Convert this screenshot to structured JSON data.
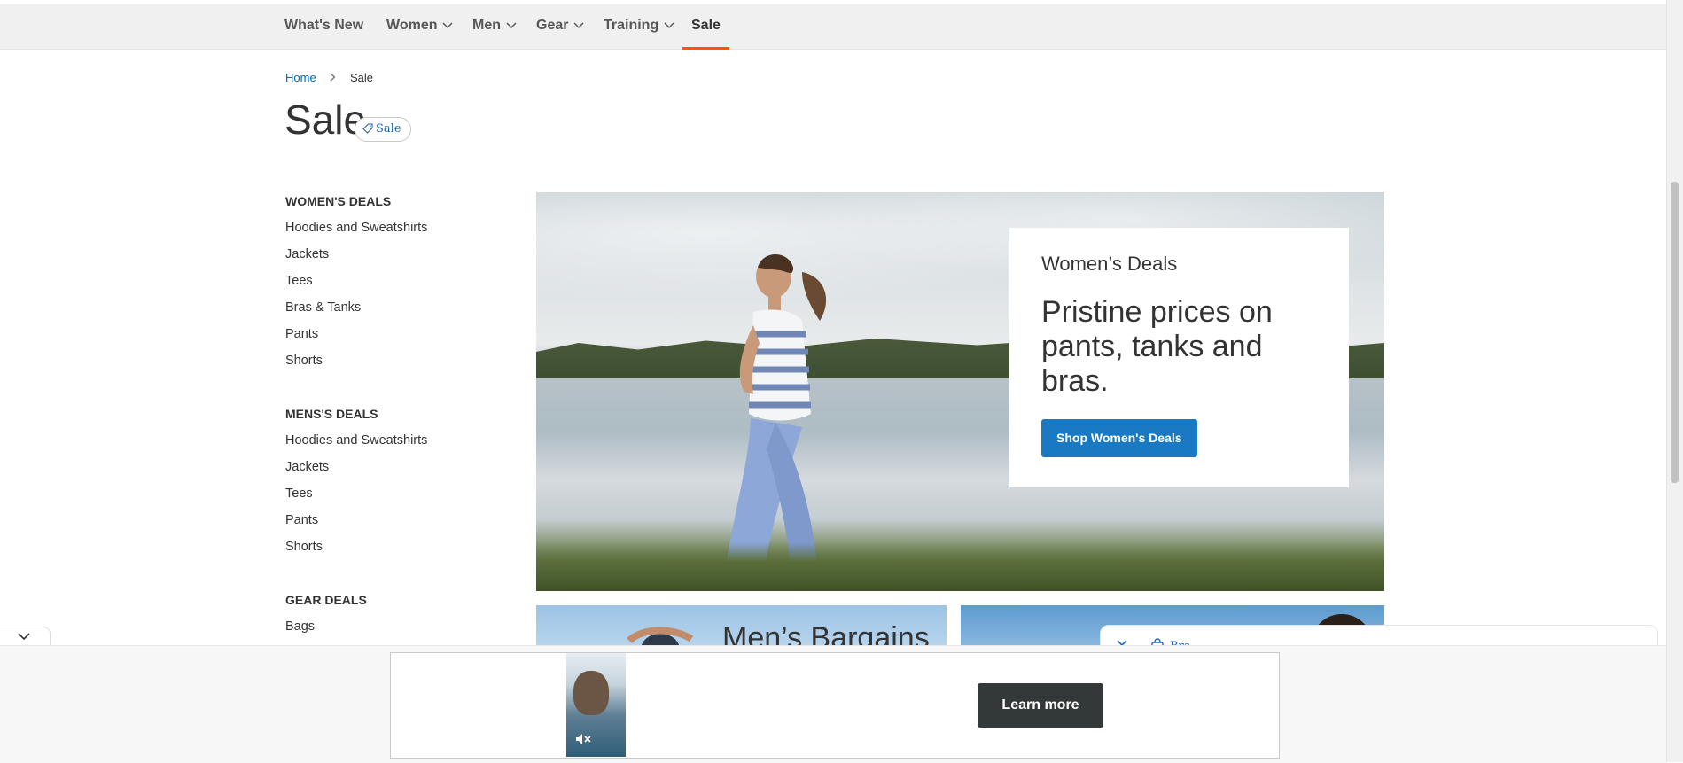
{
  "nav": {
    "items": [
      {
        "label": "What's New",
        "has_dropdown": false,
        "active": false
      },
      {
        "label": "Women",
        "has_dropdown": true,
        "active": false
      },
      {
        "label": "Men",
        "has_dropdown": true,
        "active": false
      },
      {
        "label": "Gear",
        "has_dropdown": true,
        "active": false
      },
      {
        "label": "Training",
        "has_dropdown": true,
        "active": false
      },
      {
        "label": "Sale",
        "has_dropdown": false,
        "active": true
      }
    ],
    "active_underline_color": "#ff5501"
  },
  "breadcrumb": {
    "home": "Home",
    "current": "Sale"
  },
  "page": {
    "title": "Sale",
    "badge": "Sale"
  },
  "sidebar": {
    "groups": [
      {
        "heading": "WOMEN'S DEALS",
        "links": [
          "Hoodies and Sweatshirts",
          "Jackets",
          "Tees",
          "Bras & Tanks",
          "Pants",
          "Shorts"
        ]
      },
      {
        "heading": "MENS'S DEALS",
        "links": [
          "Hoodies and Sweatshirts",
          "Jackets",
          "Tees",
          "Pants",
          "Shorts"
        ]
      },
      {
        "heading": "GEAR DEALS",
        "links": [
          "Bags"
        ]
      }
    ]
  },
  "hero": {
    "kicker": "Women’s Deals",
    "headline": "Pristine prices on pants, tanks and bras.",
    "cta": "Shop Women's Deals",
    "cta_color": "#1979c3"
  },
  "promos": {
    "left_title": "Men’s Bargains"
  },
  "ad_panel": {
    "label": "Bra"
  },
  "ad": {
    "button": "Learn more",
    "button_color": "#333839"
  },
  "icons": [
    "chevron-down-icon",
    "tag-icon",
    "shopping-bag-icon",
    "mute-icon"
  ]
}
